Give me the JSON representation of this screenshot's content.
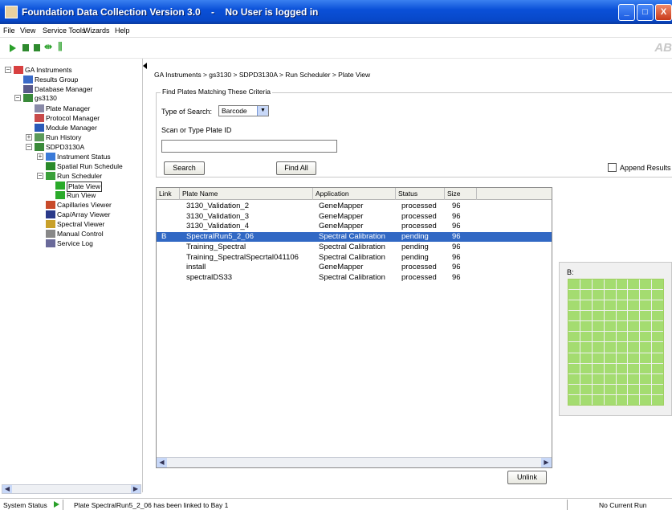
{
  "window": {
    "title": "Foundation Data Collection Version 3.0    -    No User is logged in",
    "buttons": {
      "minimize": "_",
      "maximize": "□",
      "close": "X"
    }
  },
  "menu": [
    "File",
    "View",
    "Service Tools",
    "Wizards",
    "Help"
  ],
  "toolbar": {
    "icons": [
      "play-icon",
      "stop-icon",
      "stop-icon",
      "skip-icon",
      "pause-icon"
    ],
    "brand": "AB"
  },
  "tree": [
    {
      "label": "GA Instruments",
      "level": 0,
      "expander": "−",
      "icon": "ga-instruments-icon"
    },
    {
      "label": "Results Group",
      "level": 1,
      "icon": "results-group-icon"
    },
    {
      "label": "Database Manager",
      "level": 1,
      "icon": "database-icon"
    },
    {
      "label": "gs3130",
      "level": 1,
      "expander": "−",
      "icon": "instrument-icon"
    },
    {
      "label": "Plate Manager",
      "level": 2,
      "icon": "plate-icon"
    },
    {
      "label": "Protocol Manager",
      "level": 2,
      "icon": "protocol-icon"
    },
    {
      "label": "Module Manager",
      "level": 2,
      "icon": "module-icon"
    },
    {
      "label": "Run History",
      "level": 2,
      "expander": "+",
      "icon": "run-history-icon"
    },
    {
      "label": "SDPD3130A",
      "level": 2,
      "expander": "−",
      "icon": "instrument-icon"
    },
    {
      "label": "Instrument Status",
      "level": 3,
      "expander": "+",
      "icon": "status-icon"
    },
    {
      "label": "Spatial Run Schedule",
      "level": 3,
      "icon": "spatial-icon"
    },
    {
      "label": "Run Scheduler",
      "level": 3,
      "expander": "−",
      "icon": "scheduler-icon"
    },
    {
      "label": "Plate View",
      "level": 4,
      "icon": "plate-view-icon",
      "selected": true
    },
    {
      "label": "Run View",
      "level": 4,
      "icon": "run-view-icon"
    },
    {
      "label": "Capillaries Viewer",
      "level": 3,
      "icon": "capillaries-icon"
    },
    {
      "label": "Cap/Array Viewer",
      "level": 3,
      "icon": "cap-array-icon"
    },
    {
      "label": "Spectral Viewer",
      "level": 3,
      "icon": "spectral-icon"
    },
    {
      "label": "Manual Control",
      "level": 3,
      "icon": "manual-control-icon"
    },
    {
      "label": "Service Log",
      "level": 3,
      "icon": "service-log-icon"
    }
  ],
  "breadcrumb": "GA Instruments > gs3130 > SDPD3130A > Run Scheduler > Plate View",
  "criteria": {
    "legend": "Find Plates Matching These Criteria",
    "type_label": "Type of Search:",
    "type_value": "Barcode",
    "scan_label": "Scan or Type Plate ID",
    "input_value": "",
    "search_button": "Search",
    "find_all_button": "Find All",
    "append_label": "Append Results"
  },
  "table": {
    "columns": [
      "Link",
      "Plate Name",
      "Application",
      "Status",
      "Size"
    ],
    "rows": [
      {
        "link": "",
        "name": "3130_Validation_2",
        "application": "GeneMapper",
        "status": "processed",
        "size": "96"
      },
      {
        "link": "",
        "name": "3130_Validation_3",
        "application": "GeneMapper",
        "status": "processed",
        "size": "96"
      },
      {
        "link": "",
        "name": "3130_Validation_4",
        "application": "GeneMapper",
        "status": "processed",
        "size": "96"
      },
      {
        "link": "B",
        "name": "SpectralRun5_2_06",
        "application": "Spectral Calibration",
        "status": "pending",
        "size": "96",
        "selected": true
      },
      {
        "link": "",
        "name": "Training_Spectral",
        "application": "Spectral Calibration",
        "status": "pending",
        "size": "96"
      },
      {
        "link": "",
        "name": "Training_SpectralSpecrtal041106",
        "application": "Spectral Calibration",
        "status": "pending",
        "size": "96"
      },
      {
        "link": "",
        "name": "install",
        "application": "GeneMapper",
        "status": "processed",
        "size": "96"
      },
      {
        "link": "",
        "name": "spectralDS33",
        "application": "Spectral Calibration",
        "status": "processed",
        "size": "96"
      }
    ],
    "unlink_button": "Unlink"
  },
  "plate_view": {
    "label": "B:",
    "rows": 12,
    "cols": 8,
    "well_color": "#a4dc70"
  },
  "status_bar": {
    "label": "System Status",
    "message": "Plate SpectralRun5_2_06 has been linked to Bay 1",
    "run_status": "No Current Run"
  },
  "colors": {
    "selection": "#3168c4",
    "titlebar": "#0a50d8",
    "accent_green": "#2aa02a"
  }
}
